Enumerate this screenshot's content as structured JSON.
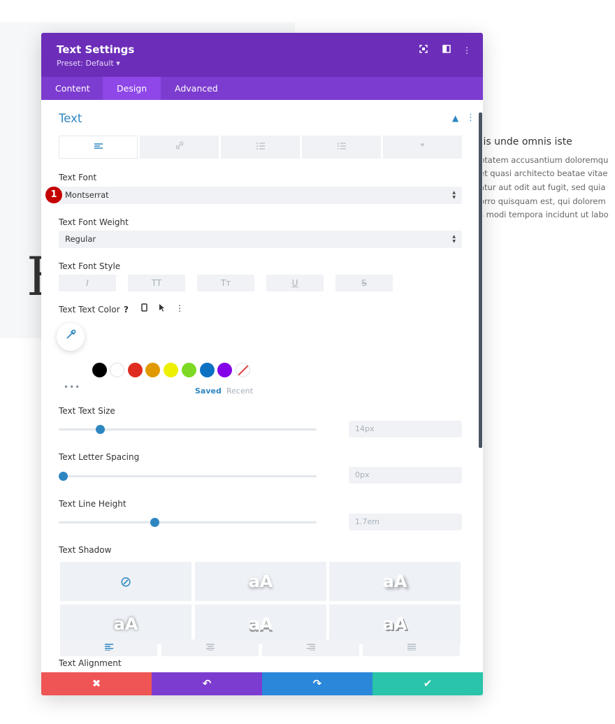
{
  "background": {
    "big_letter": "H",
    "title": "tis unde omnis iste",
    "lines": [
      "ptatem accusantium doloremqu",
      "et quasi architecto beatae vitae",
      "atur aut odit aut fugit, sed quia",
      "orro quisquam est, qui dolorem",
      "s modi tempora incidunt ut labo"
    ]
  },
  "modal": {
    "title": "Text Settings",
    "preset": "Preset: Default ▾",
    "header_icons": [
      "fullscreen-icon",
      "sidebar-icon",
      "kebab-menu-icon"
    ],
    "tabs": [
      {
        "label": "Content",
        "active": false
      },
      {
        "label": "Design",
        "active": true
      },
      {
        "label": "Advanced",
        "active": false
      }
    ]
  },
  "section": {
    "title": "Text",
    "subtabs": [
      "align-left-icon",
      "link-icon",
      "bullet-list-icon",
      "numbered-list-icon",
      "quote-icon"
    ],
    "badge": "1",
    "font": {
      "label": "Text Font",
      "value": "Montserrat"
    },
    "weight": {
      "label": "Text Font Weight",
      "value": "Regular"
    },
    "style": {
      "label": "Text Font Style",
      "buttons": [
        "I",
        "TT",
        "Tт",
        "U",
        "S"
      ]
    },
    "color": {
      "label": "Text Text Color",
      "help_icons": [
        "help-icon",
        "mobile-icon",
        "cursor-icon",
        "kebab-menu-icon"
      ],
      "swatches": [
        "#000000",
        "#ffffff",
        "#e02b20",
        "#e09900",
        "#edf000",
        "#7cda24",
        "#0c71c3",
        "#8300e9"
      ],
      "saved_label": "Saved",
      "recent_label": "Recent"
    },
    "size": {
      "label": "Text Text Size",
      "value": "14px",
      "fraction": 0.143
    },
    "letter_spacing": {
      "label": "Text Letter Spacing",
      "value": "0px",
      "fraction": 0.0
    },
    "line_height": {
      "label": "Text Line Height",
      "value": "1.7em",
      "fraction": 0.354
    },
    "shadow": {
      "label": "Text Shadow",
      "sample": "aA"
    },
    "alignment": {
      "label": "Text Alignment",
      "options": [
        "align-left-icon",
        "align-center-icon",
        "align-right-icon",
        "align-justify-icon"
      ]
    }
  },
  "footer": {
    "buttons": [
      {
        "name": "cancel-button",
        "glyph": "✖",
        "color": "#ef5555"
      },
      {
        "name": "undo-button",
        "glyph": "↶",
        "color": "#7d3cd0"
      },
      {
        "name": "redo-button",
        "glyph": "↷",
        "color": "#2b87da"
      },
      {
        "name": "save-button",
        "glyph": "✔",
        "color": "#29c4a9"
      }
    ]
  }
}
